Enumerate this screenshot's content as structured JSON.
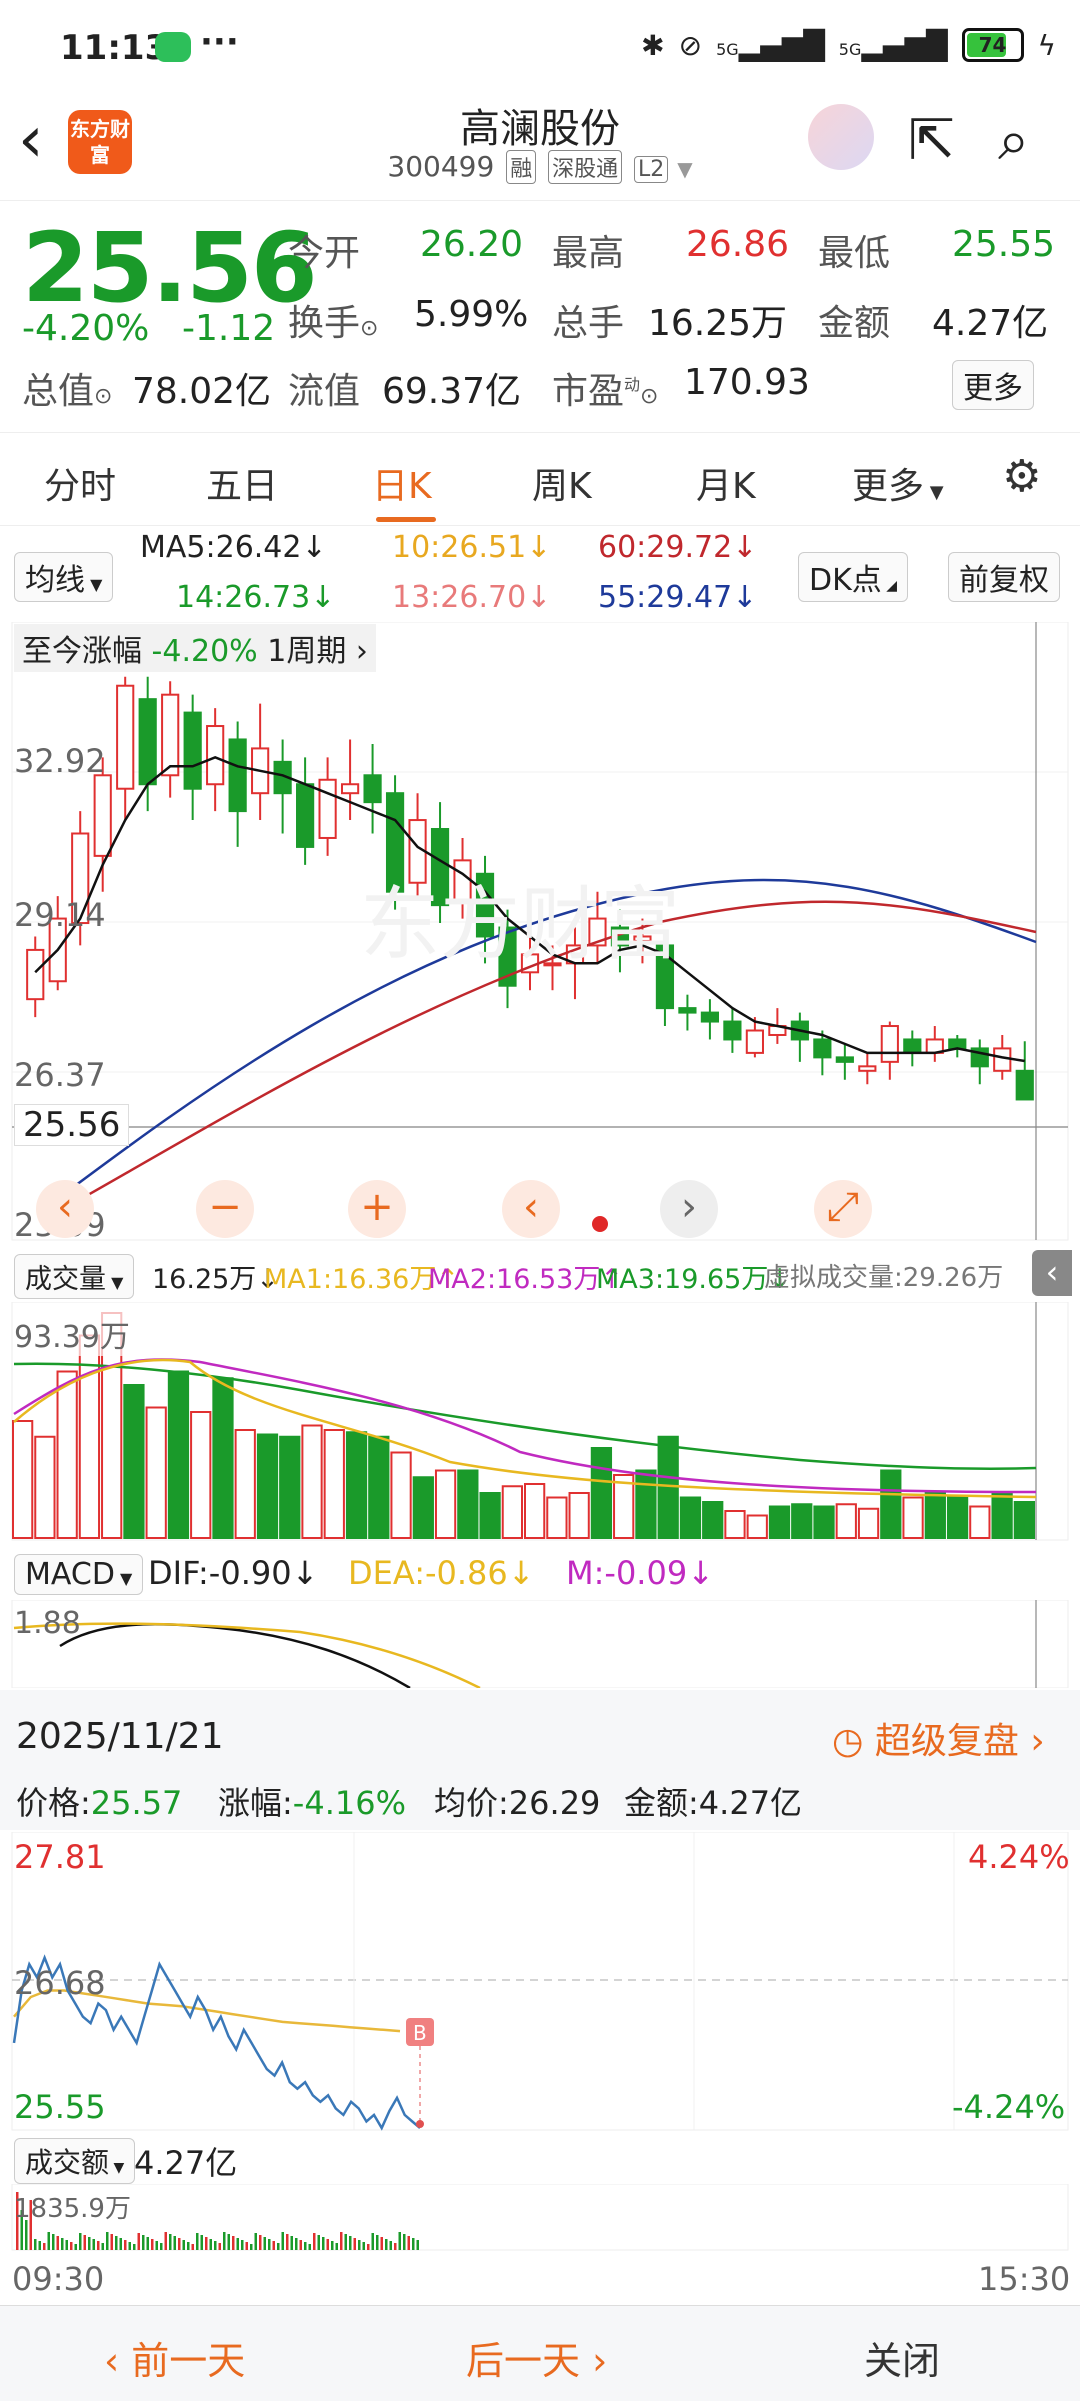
{
  "status": {
    "time": "11:13",
    "dots": "···",
    "battery": "74",
    "signal1": "5G",
    "signal2": "5G"
  },
  "header": {
    "name": "高澜股份",
    "code": "300499",
    "tags": [
      "融",
      "深股通",
      "L2"
    ],
    "logo": "东方财富"
  },
  "quote": {
    "price": "25.56",
    "pct": "-4.20%",
    "chg": "-1.12",
    "open_label": "今开",
    "open": "26.20",
    "high_label": "最高",
    "high": "26.86",
    "low_label": "最低",
    "low": "25.55",
    "turnover_label": "换手",
    "turnover": "5.99%",
    "vol_label": "总手",
    "vol": "16.25万",
    "amount_label": "金额",
    "amount": "4.27亿",
    "mktcap_label": "总值",
    "mktcap": "78.02亿",
    "float_label": "流值",
    "float": "69.37亿",
    "pe_label": "市盈",
    "pe_sup": "动",
    "pe": "170.93",
    "more": "更多"
  },
  "tabs": [
    "分时",
    "五日",
    "日K",
    "周K",
    "月K",
    "更多"
  ],
  "ma": {
    "label": "均线",
    "ma5": "MA5:26.42",
    "ma10": "10:26.51",
    "ma60": "60:29.72",
    "ma14": "14:26.73",
    "ma13": "13:26.70",
    "ma55": "55:29.47",
    "dk": "DK点",
    "fq": "前复权"
  },
  "kchart": {
    "period_label": "至今涨幅",
    "period_pct": "-4.20%",
    "period": "1周期",
    "y_top": "32.92",
    "y_mid": "29.14",
    "y_low": "26.37",
    "y_bottom": "23.09",
    "cur": "25.56",
    "candles": [
      [
        27.8,
        28.9,
        27.4,
        29.2
      ],
      [
        28.2,
        29.6,
        28.0,
        30.1
      ],
      [
        29.5,
        31.5,
        29.0,
        32.0
      ],
      [
        31.0,
        32.8,
        30.2,
        33.2
      ],
      [
        32.5,
        34.8,
        31.8,
        35.0
      ],
      [
        34.5,
        32.6,
        32.0,
        35.0
      ],
      [
        32.8,
        34.6,
        32.3,
        34.9
      ],
      [
        34.2,
        32.5,
        31.8,
        34.6
      ],
      [
        32.6,
        33.9,
        32.0,
        34.3
      ],
      [
        33.6,
        32.0,
        31.2,
        34.0
      ],
      [
        32.4,
        33.4,
        31.8,
        34.4
      ],
      [
        33.1,
        32.4,
        31.5,
        33.6
      ],
      [
        32.6,
        31.2,
        30.8,
        33.2
      ],
      [
        31.4,
        32.7,
        31.0,
        33.2
      ],
      [
        32.4,
        32.6,
        31.8,
        33.6
      ],
      [
        32.8,
        32.2,
        31.5,
        33.5
      ],
      [
        32.4,
        30.2,
        29.8,
        32.8
      ],
      [
        30.4,
        31.8,
        30.0,
        32.4
      ],
      [
        31.6,
        29.9,
        29.5,
        32.2
      ],
      [
        30.0,
        30.9,
        29.6,
        31.4
      ],
      [
        30.6,
        29.2,
        28.6,
        31.0
      ],
      [
        29.4,
        28.1,
        27.6,
        29.8
      ],
      [
        28.4,
        28.8,
        28.0,
        29.4
      ],
      [
        28.6,
        28.6,
        28.0,
        29.0
      ],
      [
        28.6,
        29.0,
        27.8,
        29.4
      ],
      [
        29.0,
        29.6,
        28.6,
        30.2
      ],
      [
        29.4,
        29.0,
        28.4,
        29.8
      ],
      [
        29.1,
        29.2,
        28.6,
        29.6
      ],
      [
        29.0,
        27.6,
        27.2,
        29.2
      ],
      [
        27.6,
        27.5,
        27.1,
        27.9
      ],
      [
        27.5,
        27.3,
        26.9,
        27.8
      ],
      [
        27.3,
        26.9,
        26.6,
        27.6
      ],
      [
        26.6,
        27.1,
        26.5,
        27.4
      ],
      [
        27.0,
        27.2,
        26.8,
        27.6
      ],
      [
        27.3,
        26.9,
        26.4,
        27.5
      ],
      [
        26.9,
        26.5,
        26.1,
        27.1
      ],
      [
        26.5,
        26.4,
        26.0,
        26.8
      ],
      [
        26.2,
        26.3,
        25.9,
        26.6
      ],
      [
        26.4,
        27.2,
        26.0,
        27.3
      ],
      [
        26.9,
        26.6,
        26.3,
        27.1
      ],
      [
        26.6,
        26.9,
        26.4,
        27.2
      ],
      [
        26.9,
        26.7,
        26.5,
        27.0
      ],
      [
        26.7,
        26.3,
        25.9,
        26.9
      ],
      [
        26.2,
        26.7,
        26.0,
        27.0
      ],
      [
        26.2,
        25.56,
        25.55,
        26.86
      ]
    ],
    "ma5": [
      28.4,
      28.9,
      29.6,
      30.8,
      31.8,
      32.6,
      33.0,
      33.0,
      33.2,
      33.0,
      32.9,
      32.8,
      32.6,
      32.4,
      32.2,
      32.0,
      31.8,
      31.2,
      30.9,
      30.6,
      30.2,
      29.6,
      29.2,
      28.8,
      28.6,
      28.6,
      28.9,
      29.0,
      28.8,
      28.4,
      28.0,
      27.6,
      27.3,
      27.2,
      27.1,
      27.0,
      26.8,
      26.6,
      26.6,
      26.6,
      26.6,
      26.7,
      26.6,
      26.5,
      26.42
    ]
  },
  "ctl": [
    "‹",
    "−",
    "+",
    "‹",
    "›",
    "⤢"
  ],
  "vol": {
    "label": "成交量",
    "val": "16.25万",
    "ma1": "MA1:16.36万",
    "ma2": "MA2:16.53万",
    "ma3": "MA3:19.65万",
    "virt": "虚拟成交量:29.26万",
    "ytop": "93.39万",
    "bars": [
      0.52,
      0.45,
      0.74,
      0.9,
      1.0,
      0.68,
      0.58,
      0.74,
      0.56,
      0.71,
      0.48,
      0.46,
      0.45,
      0.5,
      0.48,
      0.47,
      0.45,
      0.38,
      0.27,
      0.3,
      0.3,
      0.2,
      0.23,
      0.24,
      0.18,
      0.2,
      0.4,
      0.28,
      0.3,
      0.45,
      0.18,
      0.16,
      0.12,
      0.1,
      0.14,
      0.15,
      0.14,
      0.15,
      0.13,
      0.3,
      0.18,
      0.2,
      0.18,
      0.14,
      0.2,
      0.16
    ]
  },
  "macd": {
    "label": "MACD",
    "dif": "DIF:-0.90",
    "dea": "DEA:-0.86",
    "m": "M:-0.09",
    "ytop": "1.88"
  },
  "tinfo": {
    "date": "2025/11/21",
    "replay": "超级复盘",
    "price_label": "价格:",
    "price": "25.57",
    "pct_label": "涨幅:",
    "pct": "-4.16%",
    "avg_label": "均价:",
    "avg": "26.29",
    "amt_label": "金额:",
    "amt": "4.27亿"
  },
  "tchart": {
    "top": "27.81",
    "mid": "26.68",
    "bot": "25.55",
    "top_pct": "4.24%",
    "bot_pct": "-4.24%",
    "b": "B",
    "prices": [
      26.2,
      26.6,
      26.8,
      26.7,
      26.85,
      26.7,
      26.8,
      26.6,
      26.5,
      26.4,
      26.35,
      26.5,
      26.45,
      26.3,
      26.4,
      26.3,
      26.2,
      26.4,
      26.6,
      26.8,
      26.7,
      26.6,
      26.5,
      26.4,
      26.55,
      26.45,
      26.3,
      26.4,
      26.25,
      26.15,
      26.3,
      26.2,
      26.1,
      26.0,
      25.95,
      26.05,
      25.9,
      25.85,
      25.9,
      25.8,
      25.75,
      25.8,
      25.7,
      25.65,
      25.75,
      25.7,
      25.6,
      25.65,
      25.55,
      25.68,
      25.78,
      25.65,
      25.6,
      25.55
    ],
    "avg": [
      26.4,
      26.55,
      26.6,
      26.6,
      26.58,
      26.56,
      26.54,
      26.52,
      26.5,
      26.49,
      26.48,
      26.46,
      26.44,
      26.42,
      26.4,
      26.38,
      26.36,
      26.35,
      26.34,
      26.33,
      26.32,
      26.31,
      26.3,
      26.29
    ]
  },
  "tvol": {
    "label": "成交额",
    "val": "4.27亿",
    "ytop": "1835.9万",
    "t0": "09:30",
    "t1": "15:30"
  },
  "footer": {
    "prev": "前一天",
    "next": "后一天",
    "close": "关闭"
  }
}
